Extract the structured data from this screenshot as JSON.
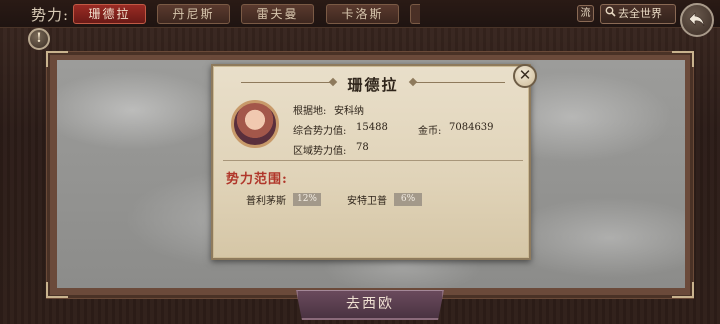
{
  "header": {
    "faction_label": "势力:",
    "tabs": [
      {
        "label": "珊德拉",
        "active": true
      },
      {
        "label": "丹尼斯",
        "active": false
      },
      {
        "label": "雷夫曼",
        "active": false
      },
      {
        "label": "卡洛斯",
        "active": false
      }
    ],
    "flow_label": "流",
    "world_button": "去全世界"
  },
  "alert_icon": "!",
  "map": {
    "goto_button": "去西欧"
  },
  "popup": {
    "title": "珊德拉",
    "close": "✕",
    "base_label": "根据地:",
    "base_value": "安科纳",
    "power_label": "综合势力值:",
    "power_value": "15488",
    "gold_label": "金币:",
    "gold_value": "7084639",
    "region_power_label": "区域势力值:",
    "region_power_value": "78",
    "range_title": "势力范围:",
    "regions": [
      {
        "name": "普利茅斯",
        "percent": "12%"
      },
      {
        "name": "安特卫普",
        "percent": "6%"
      }
    ]
  },
  "colors": {
    "active_tab": "#9a2b24",
    "range_title": "#b0362a",
    "popup_bg": "#e9dfca"
  }
}
